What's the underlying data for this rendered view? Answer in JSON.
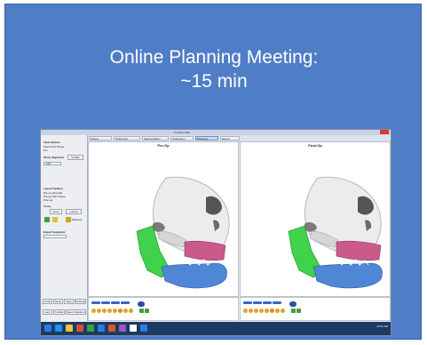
{
  "slide": {
    "title_line1": "Online Planning Meeting:",
    "title_line2": "~15 min"
  },
  "app": {
    "window_title": "ProPlan CMF",
    "toolbar": {
      "tabs": [
        "History",
        "Reference",
        "Segmentation",
        "Osteotomy",
        "Planning",
        "Export"
      ],
      "selected_tab": "Planning"
    },
    "left_panel": {
      "section1": "View Options",
      "option1": "Show Soft Tissue",
      "option2": "Pre",
      "section2": "Show Segments",
      "button_update": "Update",
      "field_value": "100",
      "section3": "Layout Options",
      "layout_opt1": "Pre-op (Frontal)",
      "layout_opt2": "Pre-op Soft Tissue",
      "layout_opt3": "Post-op",
      "label_rotate": "Rotate",
      "btn_front": "Front",
      "btn_lateral": "Lateral",
      "btn_measure": "Measure",
      "section4": "Export Segments",
      "bottom_btns": [
        "Undo",
        "Redo",
        "Save",
        "Settings"
      ],
      "bottom_btns2": [
        "Help",
        "Toolbar",
        "Save Snapshot"
      ]
    },
    "views": {
      "left_label": "Pre-Op",
      "right_label": "Post-Op"
    },
    "colors": {
      "maxilla": "#c95a89",
      "mandible": "#4f86d6",
      "ramus": "#3fd24a",
      "bone": "#e9e9e9"
    }
  },
  "taskbar": {
    "time": "10:41 AM"
  }
}
